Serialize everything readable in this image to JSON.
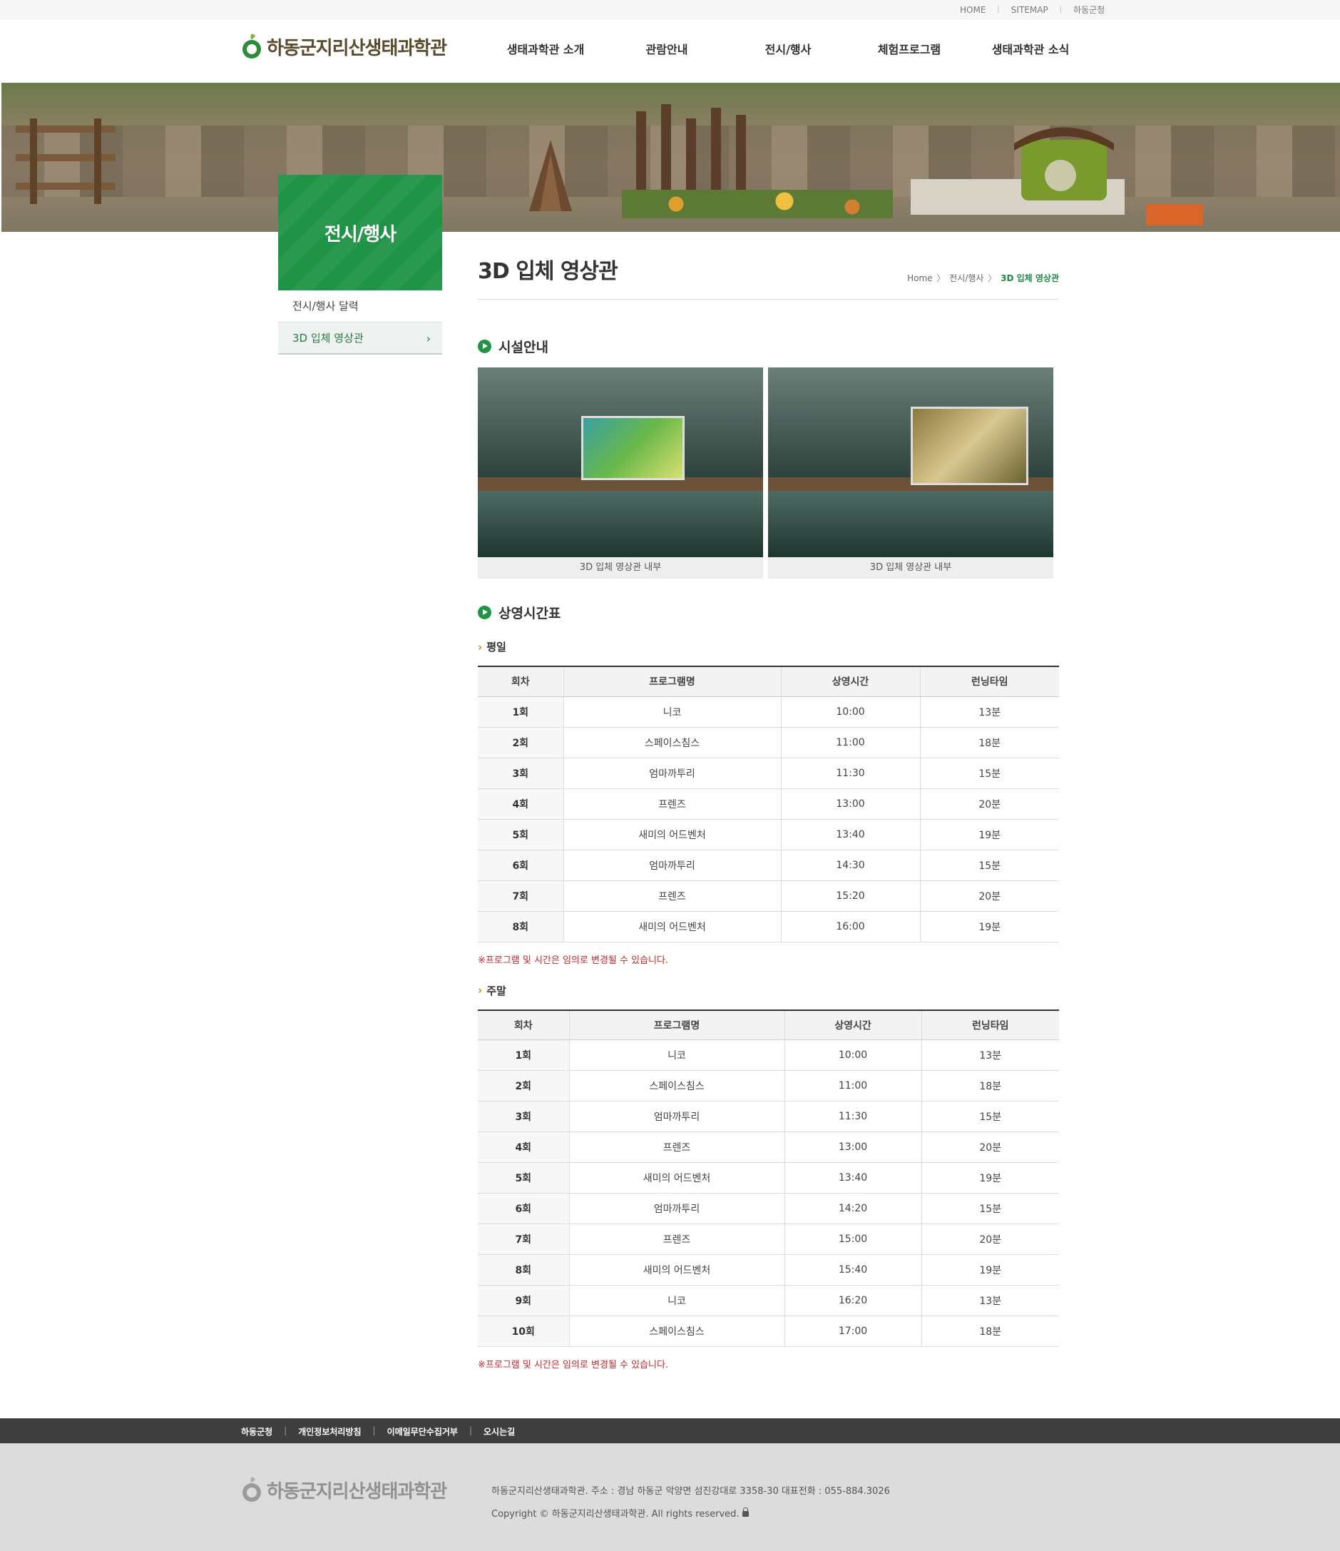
{
  "topbar": {
    "links": [
      "HOME",
      "SITEMAP",
      "하동군청"
    ]
  },
  "header": {
    "logo_text": "하동군지리산생태과학관",
    "nav": [
      "생태과학관 소개",
      "관람안내",
      "전시/행사",
      "체험프로그램",
      "생태과학관 소식"
    ]
  },
  "lnb": {
    "title": "전시/행사",
    "items": [
      {
        "label": "전시/행사 달력"
      },
      {
        "label": "3D 입체 영상관"
      }
    ]
  },
  "page": {
    "title": "3D 입체 영상관",
    "breadcrumb": {
      "home": "Home",
      "section": "전시/행사",
      "current": "3D 입체 영상관",
      "sep": "〉"
    }
  },
  "facility": {
    "title": "시설안내",
    "photos": [
      {
        "caption": "3D 입체 영상관 내부"
      },
      {
        "caption": "3D 입체 영상관 내부"
      }
    ]
  },
  "schedule": {
    "title": "상영시간표",
    "columns": [
      "회차",
      "프로그램명",
      "상영시간",
      "런닝타임"
    ],
    "weekday": {
      "label": "평일",
      "rows": [
        [
          "1회",
          "니코",
          "10:00",
          "13분"
        ],
        [
          "2회",
          "스페이스침스",
          "11:00",
          "18분"
        ],
        [
          "3회",
          "엄마까투리",
          "11:30",
          "15분"
        ],
        [
          "4회",
          "프렌즈",
          "13:00",
          "20분"
        ],
        [
          "5회",
          "새미의 어드벤처",
          "13:40",
          "19분"
        ],
        [
          "6회",
          "엄마까투리",
          "14:30",
          "15분"
        ],
        [
          "7회",
          "프렌즈",
          "15:20",
          "20분"
        ],
        [
          "8회",
          "새미의 어드벤처",
          "16:00",
          "19분"
        ]
      ],
      "notice": "※프로그램 및 시간은 임의로 변경될 수 있습니다."
    },
    "weekend": {
      "label": "주말",
      "rows": [
        [
          "1회",
          "니코",
          "10:00",
          "13분"
        ],
        [
          "2회",
          "스페이스침스",
          "11:00",
          "18분"
        ],
        [
          "3회",
          "엄마까투리",
          "11:30",
          "15분"
        ],
        [
          "4회",
          "프렌즈",
          "13:00",
          "20분"
        ],
        [
          "5회",
          "새미의 어드벤처",
          "13:40",
          "19분"
        ],
        [
          "6회",
          "엄마까투리",
          "14:20",
          "15분"
        ],
        [
          "7회",
          "프렌즈",
          "15:00",
          "20분"
        ],
        [
          "8회",
          "새미의 어드벤처",
          "15:40",
          "19분"
        ],
        [
          "9회",
          "니코",
          "16:20",
          "13분"
        ],
        [
          "10회",
          "스페이스침스",
          "17:00",
          "18분"
        ]
      ],
      "notice": "※프로그램 및 시간은 임의로 변경될 수 있습니다."
    }
  },
  "footer": {
    "links": [
      "하동군청",
      "개인정보처리방침",
      "이메일무단수집거부",
      "오시는길"
    ],
    "logo_text": "하동군지리산생태과학관",
    "address": "하동군지리산생태과학관. 주소 : 경남 하동군 악양면 섬진강대로 3358-30 대표전화 : 055-884.3026",
    "copyright": "Copyright © 하동군지리산생태과학관. All rights reserved."
  },
  "colors": {
    "brand_green": "#1f9446",
    "accent_orange": "#e08a00",
    "notice_red": "#c1272d",
    "footer_dark": "#3e3e3e"
  }
}
